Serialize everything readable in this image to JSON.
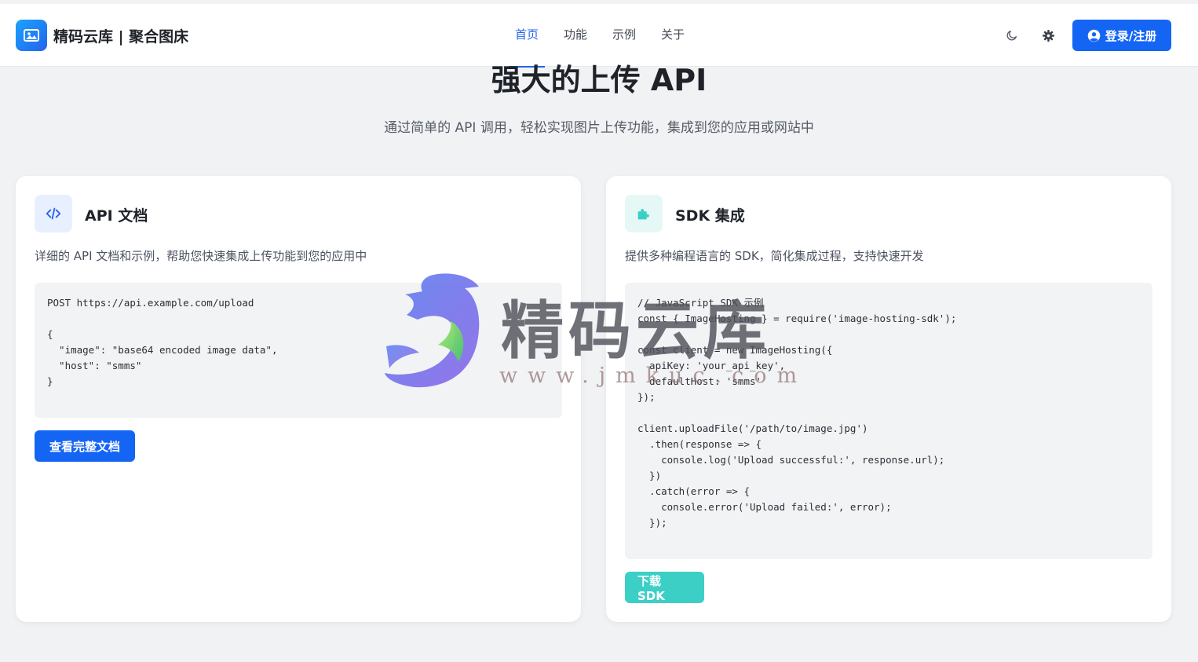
{
  "brand": {
    "name": "精码云库 | 聚合图床",
    "logo_icon": "image-icon",
    "accent": "#2563eb"
  },
  "nav": {
    "items": [
      {
        "label": "首页",
        "active": true
      },
      {
        "label": "功能",
        "active": false
      },
      {
        "label": "示例",
        "active": false
      },
      {
        "label": "关于",
        "active": false
      }
    ]
  },
  "header_actions": {
    "theme_icon": "moon-icon",
    "settings_icon": "gear-icon",
    "login_label": "登录/注册",
    "login_icon": "user-circle-icon"
  },
  "hero": {
    "title": "强大的上传 API",
    "subtitle": "通过简单的 API 调用，轻松实现图片上传功能，集成到您的应用或网站中"
  },
  "cards": [
    {
      "title": "API 文档",
      "icon": "code-icon",
      "description": "详细的 API 文档和示例，帮助您快速集成上传功能到您的应用中",
      "code": "POST https://api.example.com/upload\n\n{\n  \"image\": \"base64 encoded image data\",\n  \"host\": \"smms\"\n}",
      "button_label": "查看完整文档",
      "button_color": "#1565f5"
    },
    {
      "title": "SDK 集成",
      "icon": "puzzle-icon",
      "description": "提供多种编程语言的 SDK，简化集成过程，支持快速开发",
      "code": "// JavaScript SDK 示例\nconst { ImageHosting } = require('image-hosting-sdk');\n\nconst client = new ImageHosting({\n  apiKey: 'your_api_key',\n  defaultHost: 'smms'\n});\n\nclient.uploadFile('/path/to/image.jpg')\n  .then(response => {\n    console.log('Upload successful:', response.url);\n  })\n  .catch(error => {\n    console.error('Upload failed:', error);\n  });",
      "button_label": "下载 SDK",
      "button_color": "#3ccfc6"
    }
  ],
  "watermark": {
    "text": "精码云库",
    "url": "www.jmkuc.com"
  }
}
